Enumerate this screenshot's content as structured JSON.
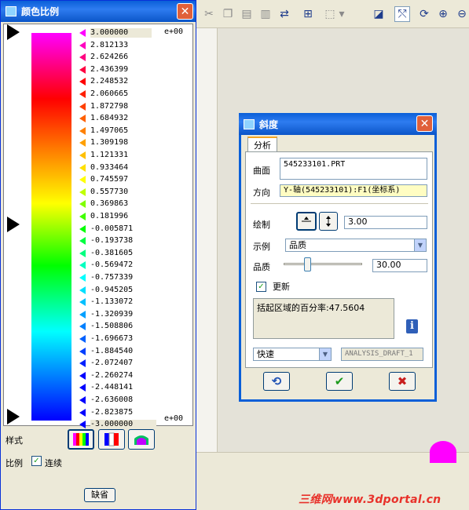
{
  "color_window": {
    "title": "颜色比例",
    "close": "✕",
    "exponent_top": "e+00",
    "exponent_bottom": "e+00",
    "scale_values": [
      "3.000000",
      "2.812133",
      "2.624266",
      "2.436399",
      "2.248532",
      "2.060665",
      "1.872798",
      "1.684932",
      "1.497065",
      "1.309198",
      "1.121331",
      "0.933464",
      "0.745597",
      "0.557730",
      "0.369863",
      "0.181996",
      "-0.005871",
      "-0.193738",
      "-0.381605",
      "-0.569472",
      "-0.757339",
      "-0.945205",
      "-1.133072",
      "-1.320939",
      "-1.508806",
      "-1.696673",
      "-1.884540",
      "-2.072407",
      "-2.260274",
      "-2.448141",
      "-2.636008",
      "-2.823875",
      "-3.000000"
    ],
    "tick_colors": [
      "#ff00ff",
      "#ff00c0",
      "#ff0080",
      "#ff0040",
      "#ff0000",
      "#ff2000",
      "#ff4000",
      "#ff6000",
      "#ff8000",
      "#ffa000",
      "#ffc000",
      "#ffe000",
      "#ffff00",
      "#c0ff00",
      "#80ff00",
      "#40ff00",
      "#00ff00",
      "#00ff40",
      "#00ff80",
      "#00ffc0",
      "#00ffff",
      "#00e0ff",
      "#00c0ff",
      "#00a0ff",
      "#0080ff",
      "#0060ff",
      "#0040ff",
      "#0020ff",
      "#0000ff",
      "#0000ff",
      "#0000ff",
      "#0000ff",
      "#0000ff"
    ],
    "style_label": "样式",
    "scale_label": "比例",
    "continuous_label": "连续",
    "continuous_checked": "✓",
    "default_button": "缺省"
  },
  "slope_dialog": {
    "title": "斜度",
    "close": "✕",
    "tab": "分析",
    "surface_label": "曲面",
    "surface_value": "545233101.PRT",
    "direction_label": "方向",
    "direction_value": "Y-轴(545233101):F1(坐标系)",
    "plot_label": "绘制",
    "plot_value": "3.00",
    "display_label": "示例",
    "display_value": "品质",
    "quality_label": "品质",
    "quality_value": "30.00",
    "quality_fraction": 0.3,
    "update_label": "更新",
    "update_checked": "✓",
    "percent_text": "括起区域的百分率:47.5604",
    "info": "i",
    "speed_value": "快速",
    "analysis_name": "ANALYSIS_DRAFT_1",
    "ok_glyph": "✔",
    "cancel_glyph": "✖",
    "repeat_glyph": "⟲"
  },
  "toolbar": {
    "icons": [
      "scissors-icon",
      "copy-icon",
      "paste-icon",
      "paste-special-icon",
      "regenerate-icon",
      "find-icon",
      "select-box-icon",
      "dropdown-icon",
      "view-icon",
      "datum-icon",
      "spin-icon",
      "zoom-in-icon",
      "zoom-out-icon"
    ]
  },
  "watermark": "三维网www.3dportal.cn"
}
